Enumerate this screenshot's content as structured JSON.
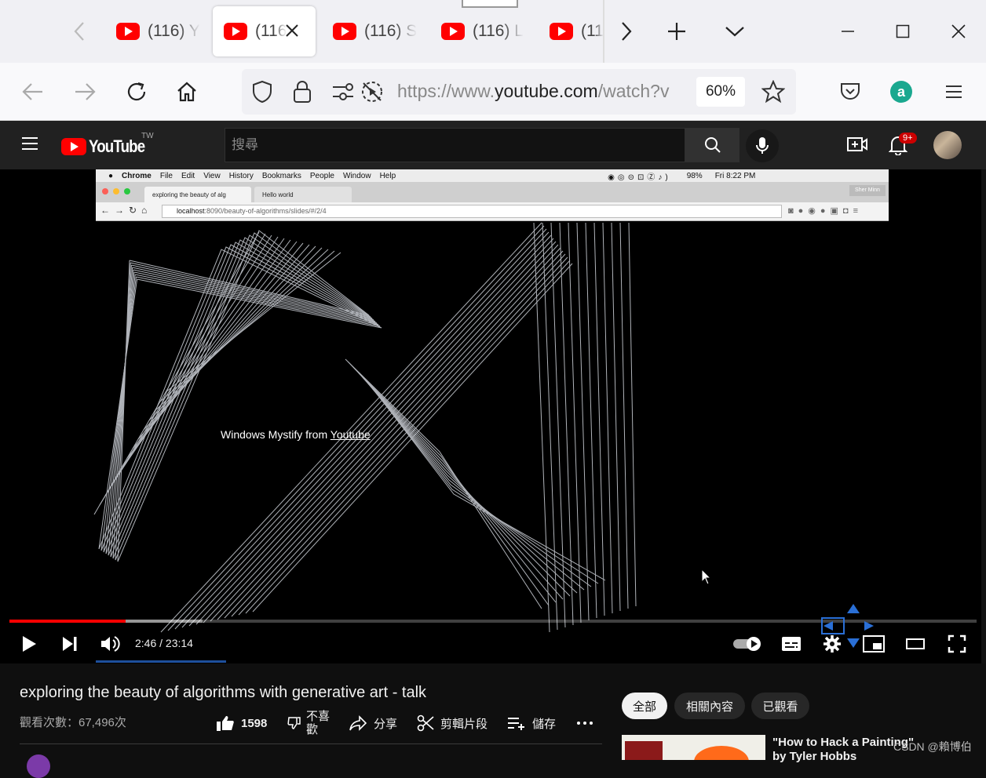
{
  "browser": {
    "tabs": [
      {
        "label": "(116) Y"
      },
      {
        "label": "(116)"
      },
      {
        "label": "(116) S"
      },
      {
        "label": "(116) L"
      },
      {
        "label": "(11"
      }
    ],
    "url_prefix": "https://www.",
    "url_domain": "youtube.com",
    "url_rest": "/watch?v",
    "zoom": "60%"
  },
  "youtube": {
    "logo_text": "YouTube",
    "region": "TW",
    "search_placeholder": "搜尋",
    "notification_count": "9+"
  },
  "inner_browser": {
    "menu": [
      "Chrome",
      "File",
      "Edit",
      "View",
      "History",
      "Bookmarks",
      "People",
      "Window",
      "Help"
    ],
    "status": "98%",
    "clock": "Fri 8:22 PM",
    "tab1": "exploring the beauty of alg",
    "tab2": "Hello world",
    "profile": "Sher Minn",
    "url_host": "localhost",
    "url_path": ":8090/beauty-of-algorithms/slides/#/2/4"
  },
  "video": {
    "caption_prefix": "Windows Mystify from ",
    "caption_link": "Youtube",
    "time": "2:46 / 23:14",
    "played_fraction": 0.12,
    "buffered_fraction": 0.2
  },
  "meta": {
    "title": "exploring the beauty of algorithms with generative art - talk",
    "views": "觀看次數：67,496次",
    "likes": "1598",
    "dislike_label_1": "不喜",
    "dislike_label_2": "歡",
    "share_label": "分享",
    "clip_label": "剪輯片段",
    "save_label": "儲存"
  },
  "sidebar": {
    "chips": [
      "全部",
      "相關內容",
      "已觀看"
    ],
    "rec_title": "\"How to Hack a Painting\" by Tyler Hobbs"
  },
  "watermark": "CSDN @賴博伯"
}
